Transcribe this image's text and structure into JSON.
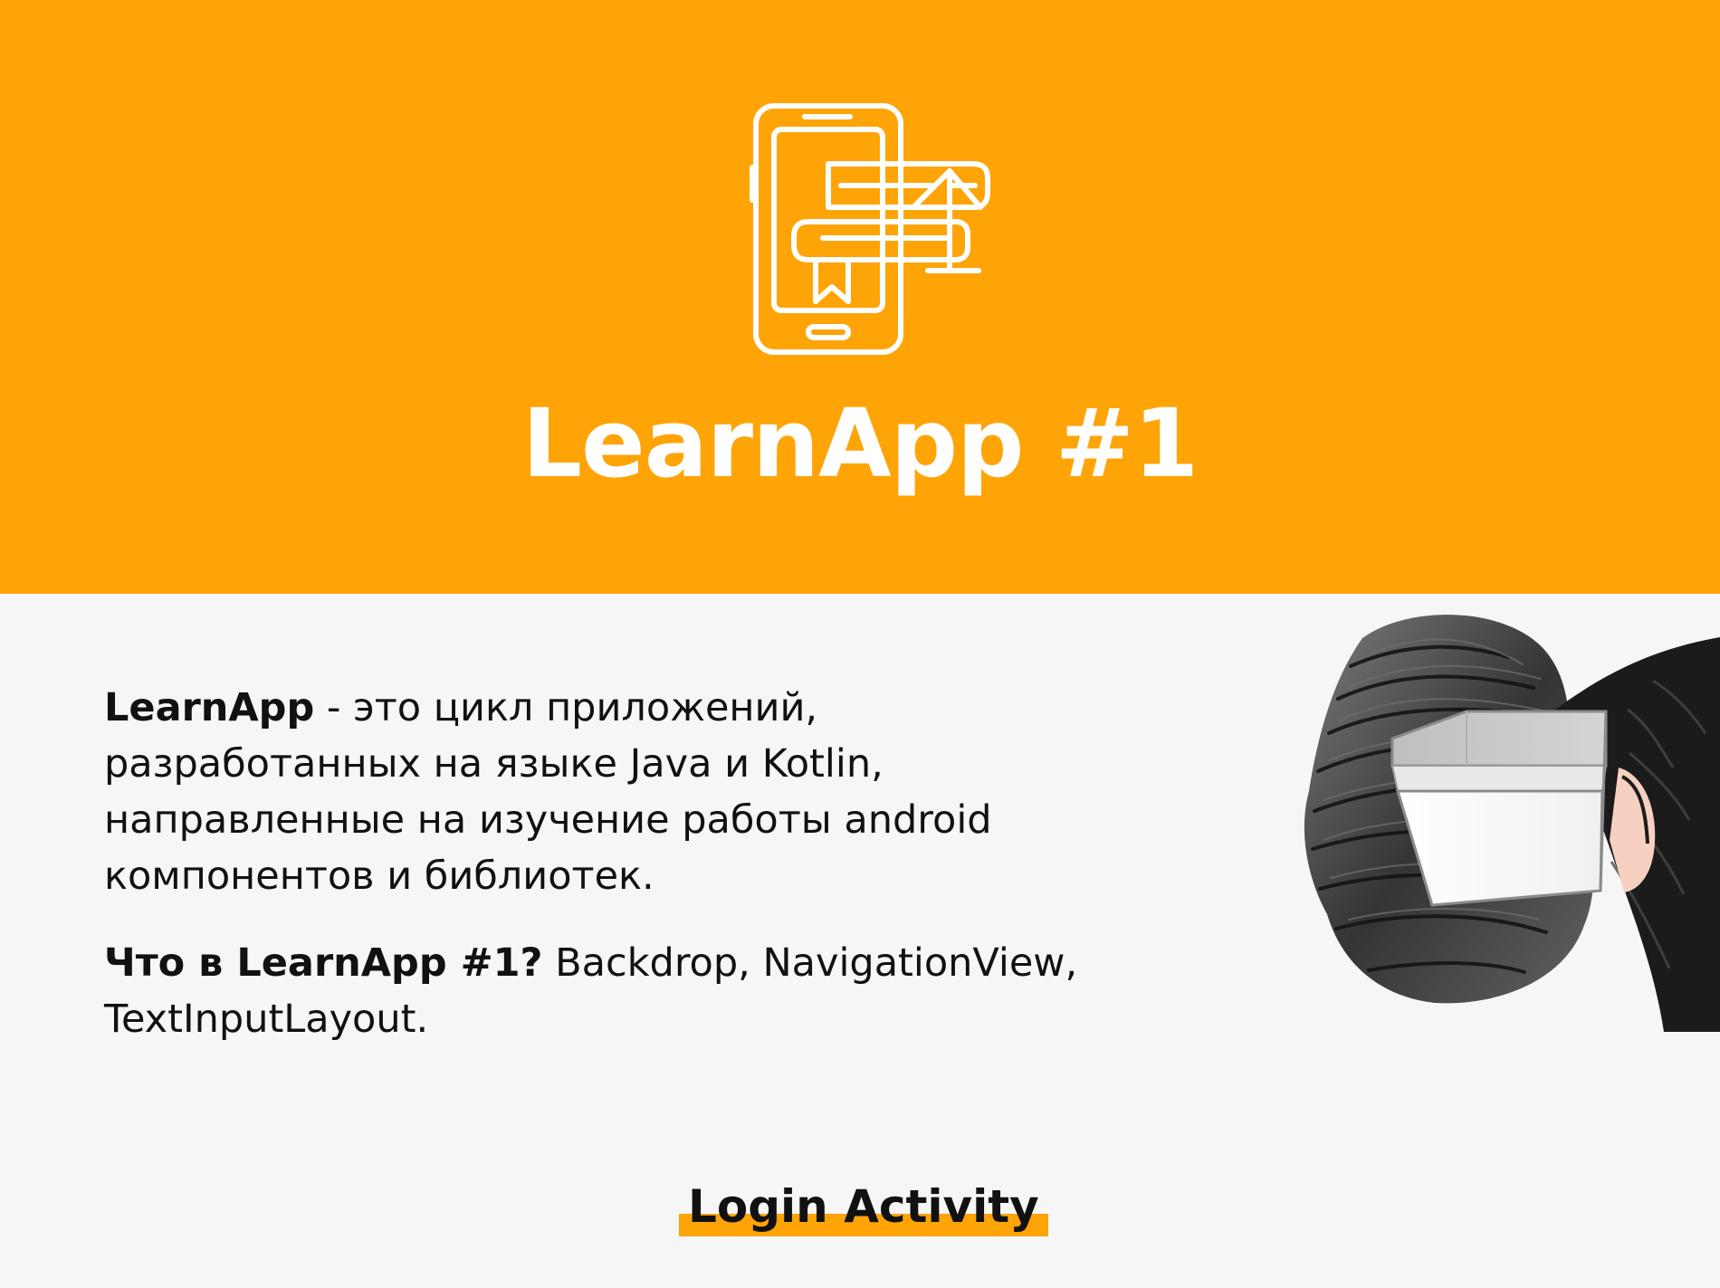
{
  "hero": {
    "title": "LearnApp #1",
    "logo_icon": "mobile-books-icon",
    "background_color": "#ffa407"
  },
  "content": {
    "paragraph1": {
      "lead": "LearnApp",
      "body": " - это цикл приложений, разработанных на языке Java и Kotlin, направленные на изучение работы android компонентов и библиотек."
    },
    "paragraph2": {
      "lead": "Что в LearnApp #1?",
      "body": " Backdrop, NavigationView, TextInputLayout."
    },
    "illustration_icon": "hair-box-illustration"
  },
  "footer": {
    "link_label": "Login Activity",
    "accent_color": "#ffa407"
  }
}
